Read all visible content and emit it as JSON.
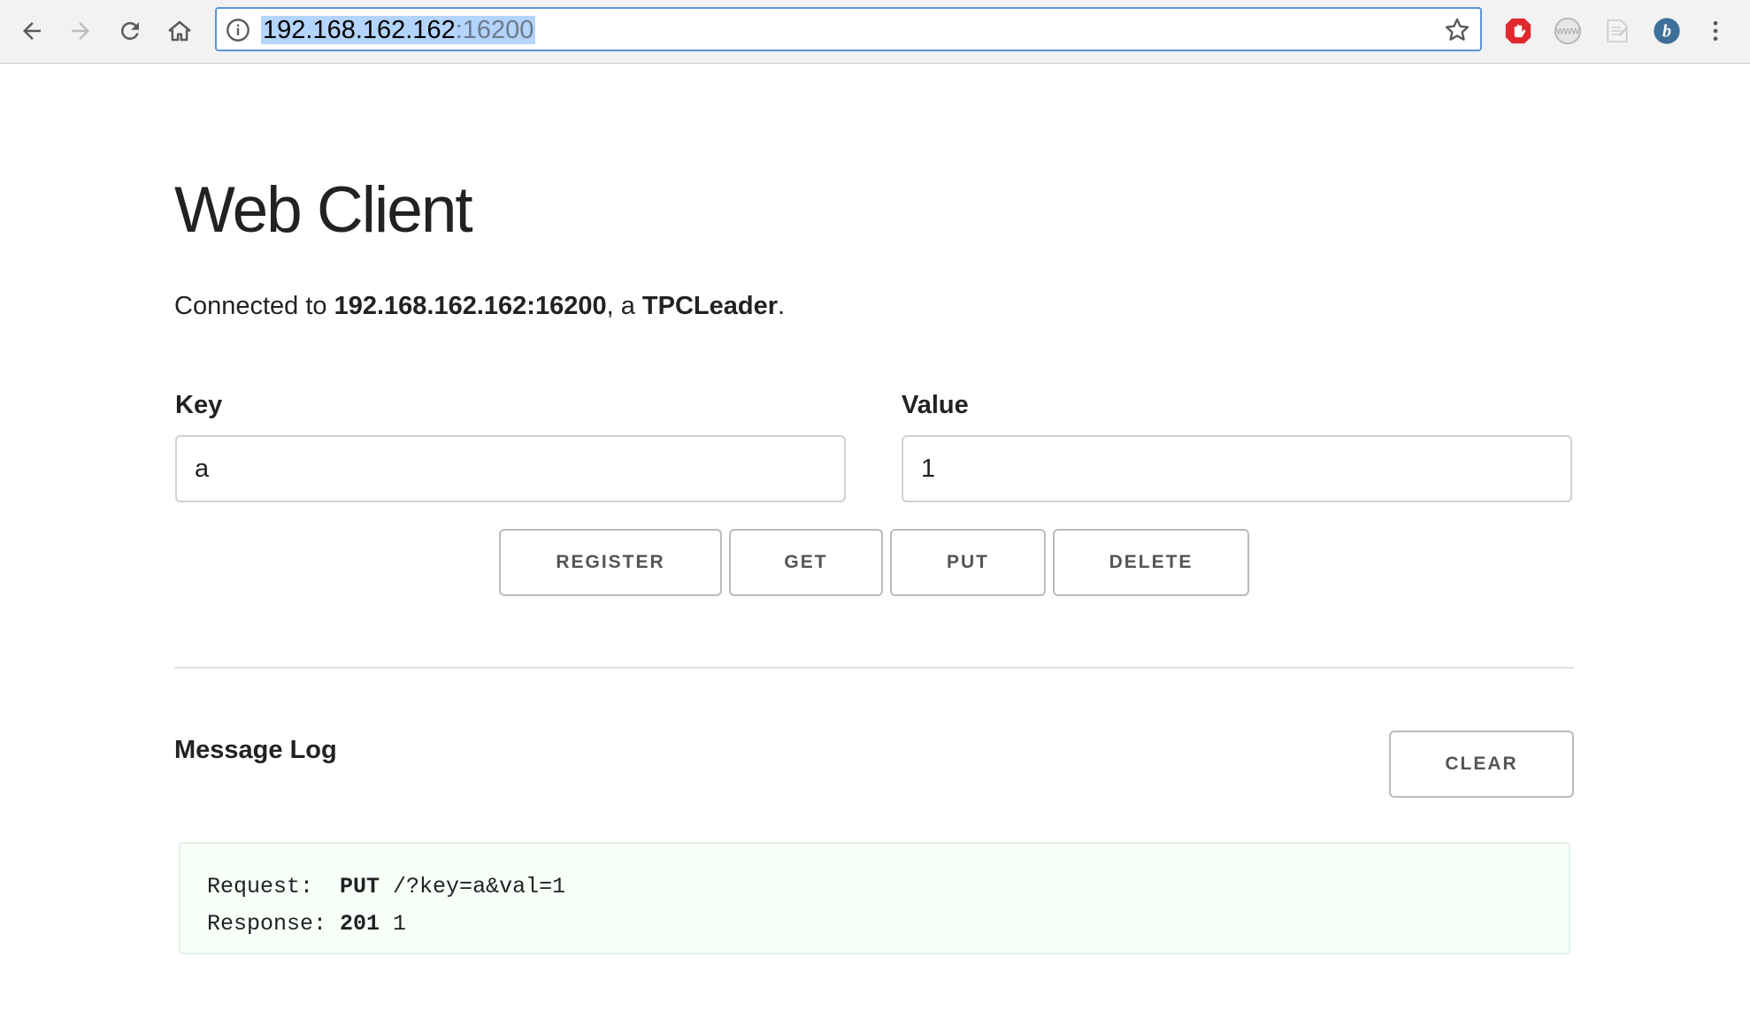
{
  "browser": {
    "url_host": "192.168.162.162",
    "url_port": ":16200"
  },
  "page": {
    "title": "Web Client",
    "connected_prefix": "Connected to ",
    "connected_address": "192.168.162.162:16200",
    "connected_mid": ", a ",
    "connected_role": "TPCLeader",
    "connected_suffix": "."
  },
  "form": {
    "key_label": "Key",
    "key_value": "a",
    "value_label": "Value",
    "value_value": "1"
  },
  "buttons": {
    "register": "REGISTER",
    "get": "GET",
    "put": "PUT",
    "delete": "DELETE",
    "clear": "CLEAR"
  },
  "log": {
    "title": "Message Log",
    "request_label": "Request:  ",
    "request_method": "PUT",
    "request_path": " /?key=a&val=1",
    "response_label": "Response: ",
    "response_code": "201",
    "response_body": " 1"
  },
  "icons": {
    "back": "arrow-left-icon",
    "forward": "arrow-right-icon",
    "reload": "reload-icon",
    "home": "home-icon",
    "info": "info-icon",
    "star": "star-icon",
    "adblock": "adblock-icon",
    "www": "www-icon",
    "note": "note-icon",
    "bitly": "bitly-icon",
    "menu": "kebab-menu-icon"
  },
  "colors": {
    "omnibox_border": "#5c95d6",
    "url_highlight": "#b3d4fc",
    "log_background": "#f6fff8",
    "adblock_red": "#e0282e",
    "bitly_blue": "#3d6f9a"
  }
}
